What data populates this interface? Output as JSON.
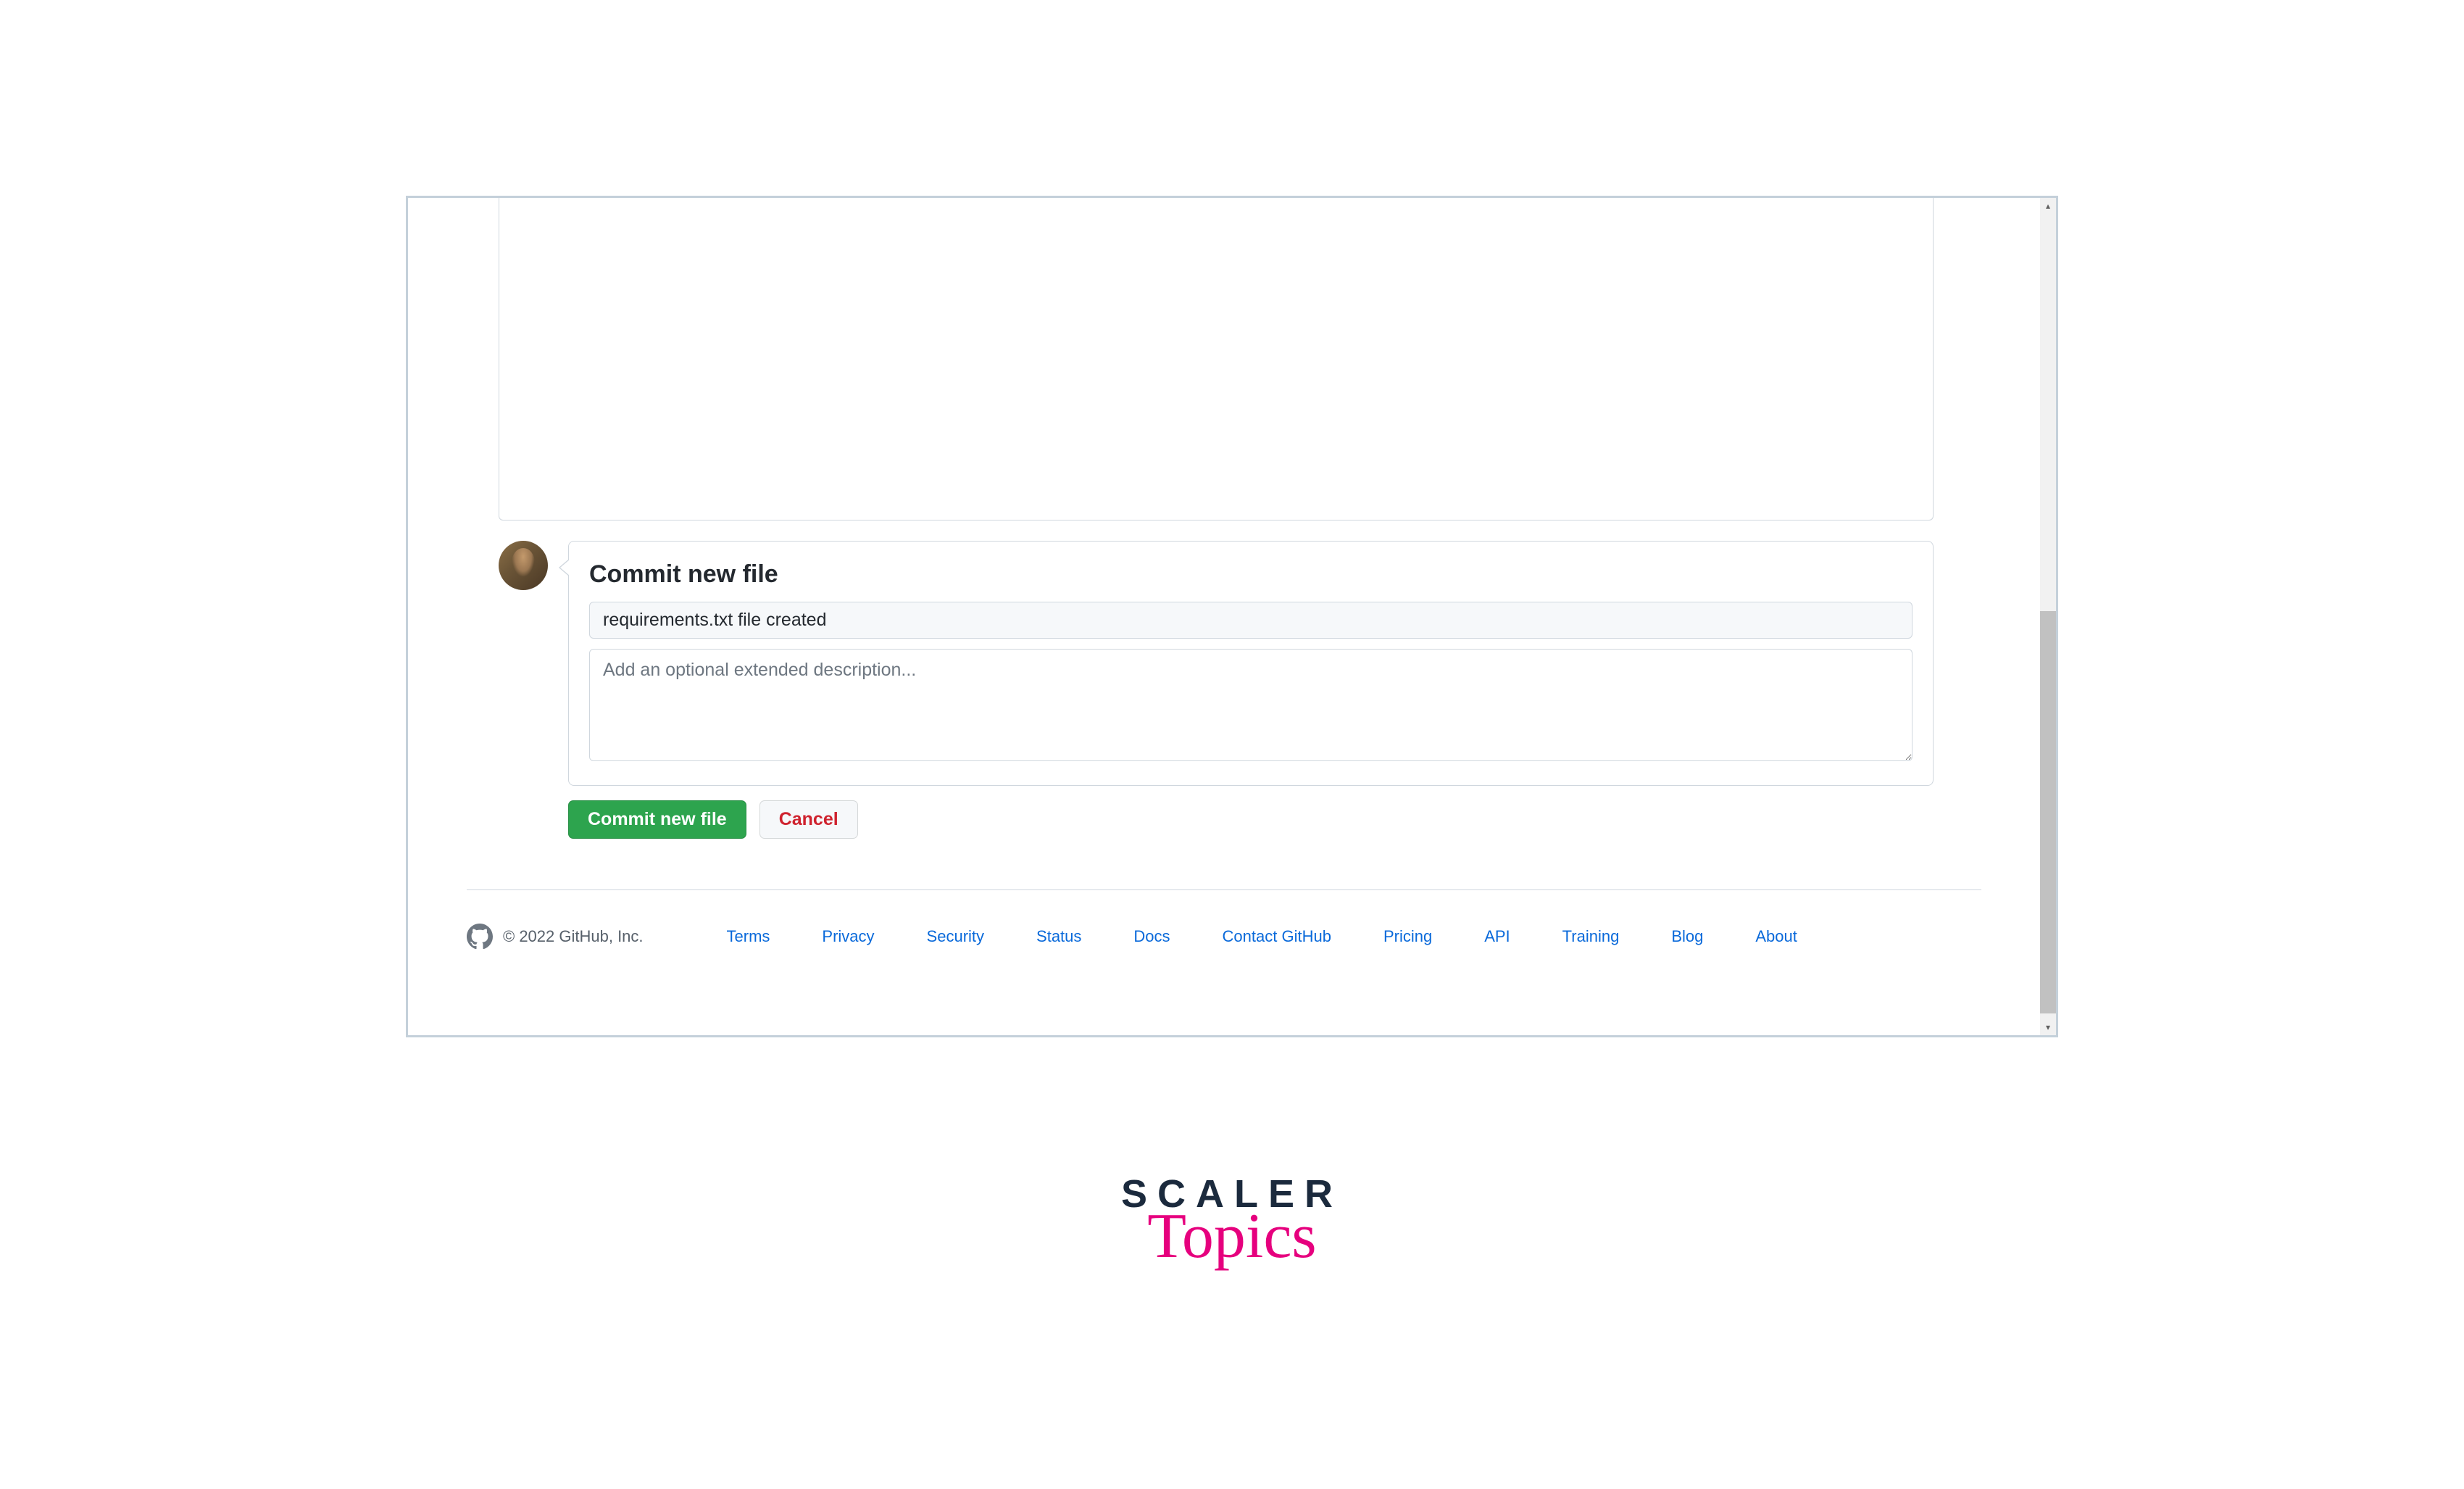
{
  "commit": {
    "title": "Commit new file",
    "summary_value": "requirements.txt file created",
    "description_placeholder": "Add an optional extended description..."
  },
  "actions": {
    "commit_label": "Commit new file",
    "cancel_label": "Cancel"
  },
  "footer": {
    "copyright": "© 2022 GitHub, Inc.",
    "links": {
      "terms": "Terms",
      "privacy": "Privacy",
      "security": "Security",
      "status": "Status",
      "docs": "Docs",
      "contact": "Contact GitHub",
      "pricing": "Pricing",
      "api": "API",
      "training": "Training",
      "blog": "Blog",
      "about": "About"
    }
  },
  "brand": {
    "line1": "SCALER",
    "line2": "Topics"
  }
}
